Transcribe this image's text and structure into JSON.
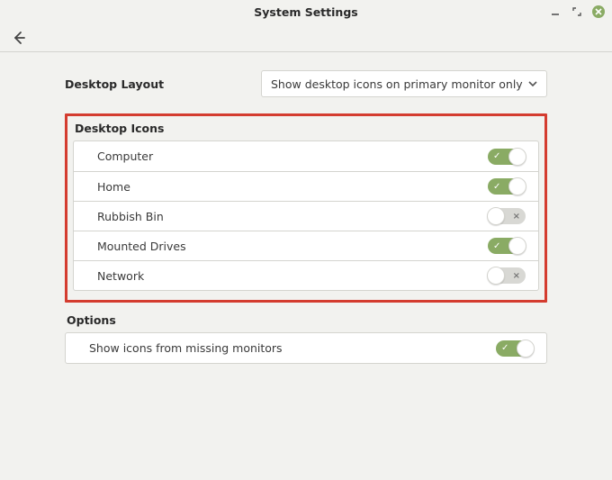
{
  "window": {
    "title": "System Settings"
  },
  "desktop_layout": {
    "label": "Desktop Layout",
    "selected": "Show desktop icons on primary monitor only"
  },
  "sections": {
    "desktop_icons": {
      "title": "Desktop Icons",
      "items": [
        {
          "label": "Computer",
          "enabled": true
        },
        {
          "label": "Home",
          "enabled": true
        },
        {
          "label": "Rubbish Bin",
          "enabled": false
        },
        {
          "label": "Mounted Drives",
          "enabled": true
        },
        {
          "label": "Network",
          "enabled": false
        }
      ]
    },
    "options": {
      "title": "Options",
      "items": [
        {
          "label": "Show icons from missing monitors",
          "enabled": true
        }
      ]
    }
  },
  "marks": {
    "on": "✓",
    "off": "×"
  }
}
